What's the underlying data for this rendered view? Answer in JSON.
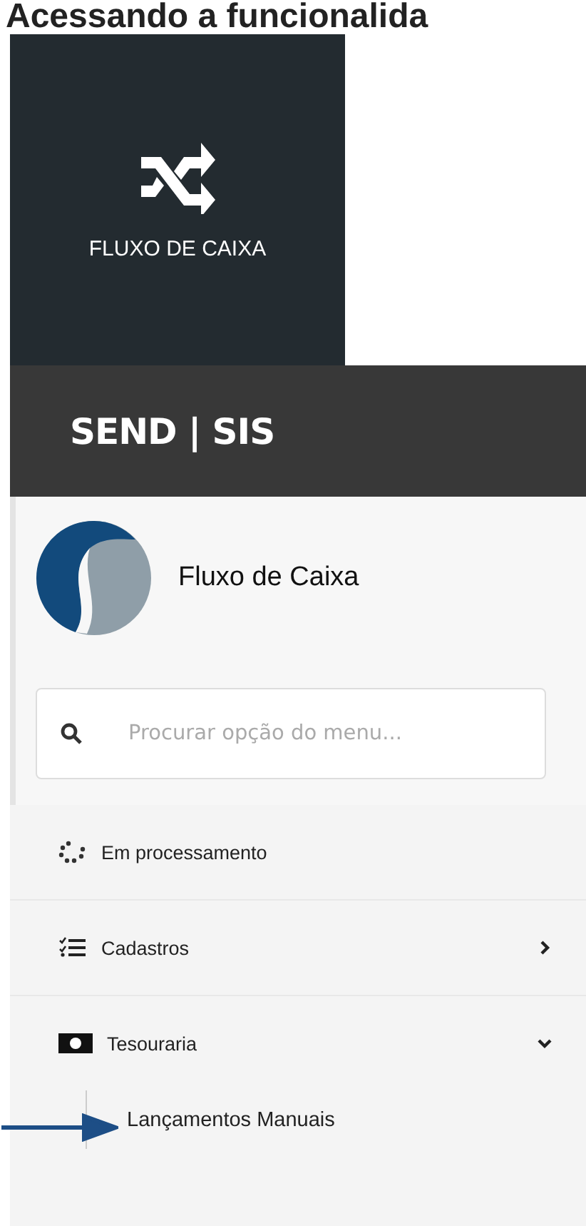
{
  "heading": "Acessando a funcionalida",
  "tile": {
    "label": "FLUXO DE CAIXA"
  },
  "header": {
    "title": "SEND | SIS"
  },
  "sidebar": {
    "app_title": "Fluxo de Caixa",
    "search": {
      "placeholder": "Procurar opção do menu..."
    },
    "items": [
      {
        "kind": "spinner",
        "label": "Em processamento"
      },
      {
        "kind": "list",
        "label": "Cadastros",
        "expanded": false
      },
      {
        "kind": "money",
        "label": "Tesouraria",
        "expanded": true,
        "children": [
          {
            "label": "Lançamentos Manuais"
          }
        ]
      }
    ]
  }
}
